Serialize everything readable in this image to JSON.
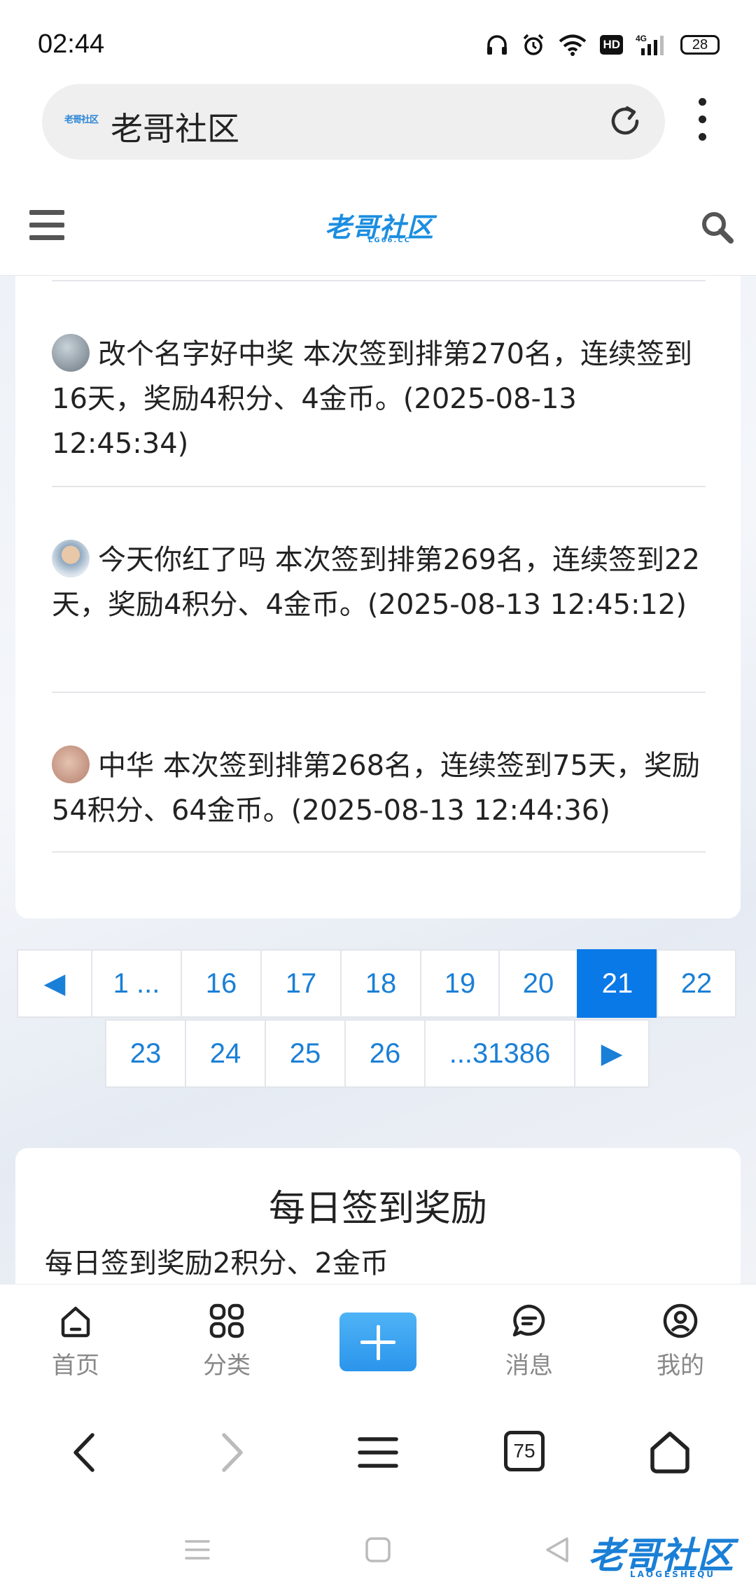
{
  "status_bar": {
    "time": "02:44",
    "battery": "28",
    "hd_label": "HD",
    "network": "4G"
  },
  "browser": {
    "favicon_text": "老哥社区",
    "page_title": "老哥社区",
    "tab_count": "75"
  },
  "site_header": {
    "logo_text": "老哥社区",
    "logo_sub": "LG66.CC"
  },
  "entries": [
    {
      "name": "改个名字好中奖",
      "text": "改个名字好中奖 本次签到排第270名，连续签到16天，奖励4积分、4金币。(2025-08-13 12:45:34)",
      "avatar_color": "#7d8a94"
    },
    {
      "name": "今天你红了吗",
      "text": "今天你红了吗 本次签到排第269名，连续签到22天，奖励4积分、4金币。(2025-08-13 12:45:12)",
      "avatar_color": "#a9b8c6"
    },
    {
      "name": "中华",
      "text": "中华 本次签到排第268名，连续签到75天，奖励54积分、64金币。(2025-08-13 12:44:36)",
      "avatar_color": "#c9a08c"
    }
  ],
  "pagination": {
    "row1": [
      "◀",
      "1 ...",
      "16",
      "17",
      "18",
      "19",
      "20",
      "21",
      "22"
    ],
    "row2": [
      "23",
      "24",
      "25",
      "26",
      "...31386",
      "▶"
    ],
    "current": "21"
  },
  "reward": {
    "title": "每日签到奖励",
    "description": "每日签到奖励2积分、2金币"
  },
  "bottom_nav": {
    "home": "首页",
    "category": "分类",
    "messages": "消息",
    "mine": "我的"
  },
  "watermark": {
    "text": "老哥社区",
    "sub": "LAOGESHEQU"
  },
  "colors": {
    "accent": "#0a79e8",
    "link": "#1a7fd6",
    "logo": "#1b8ee0"
  }
}
